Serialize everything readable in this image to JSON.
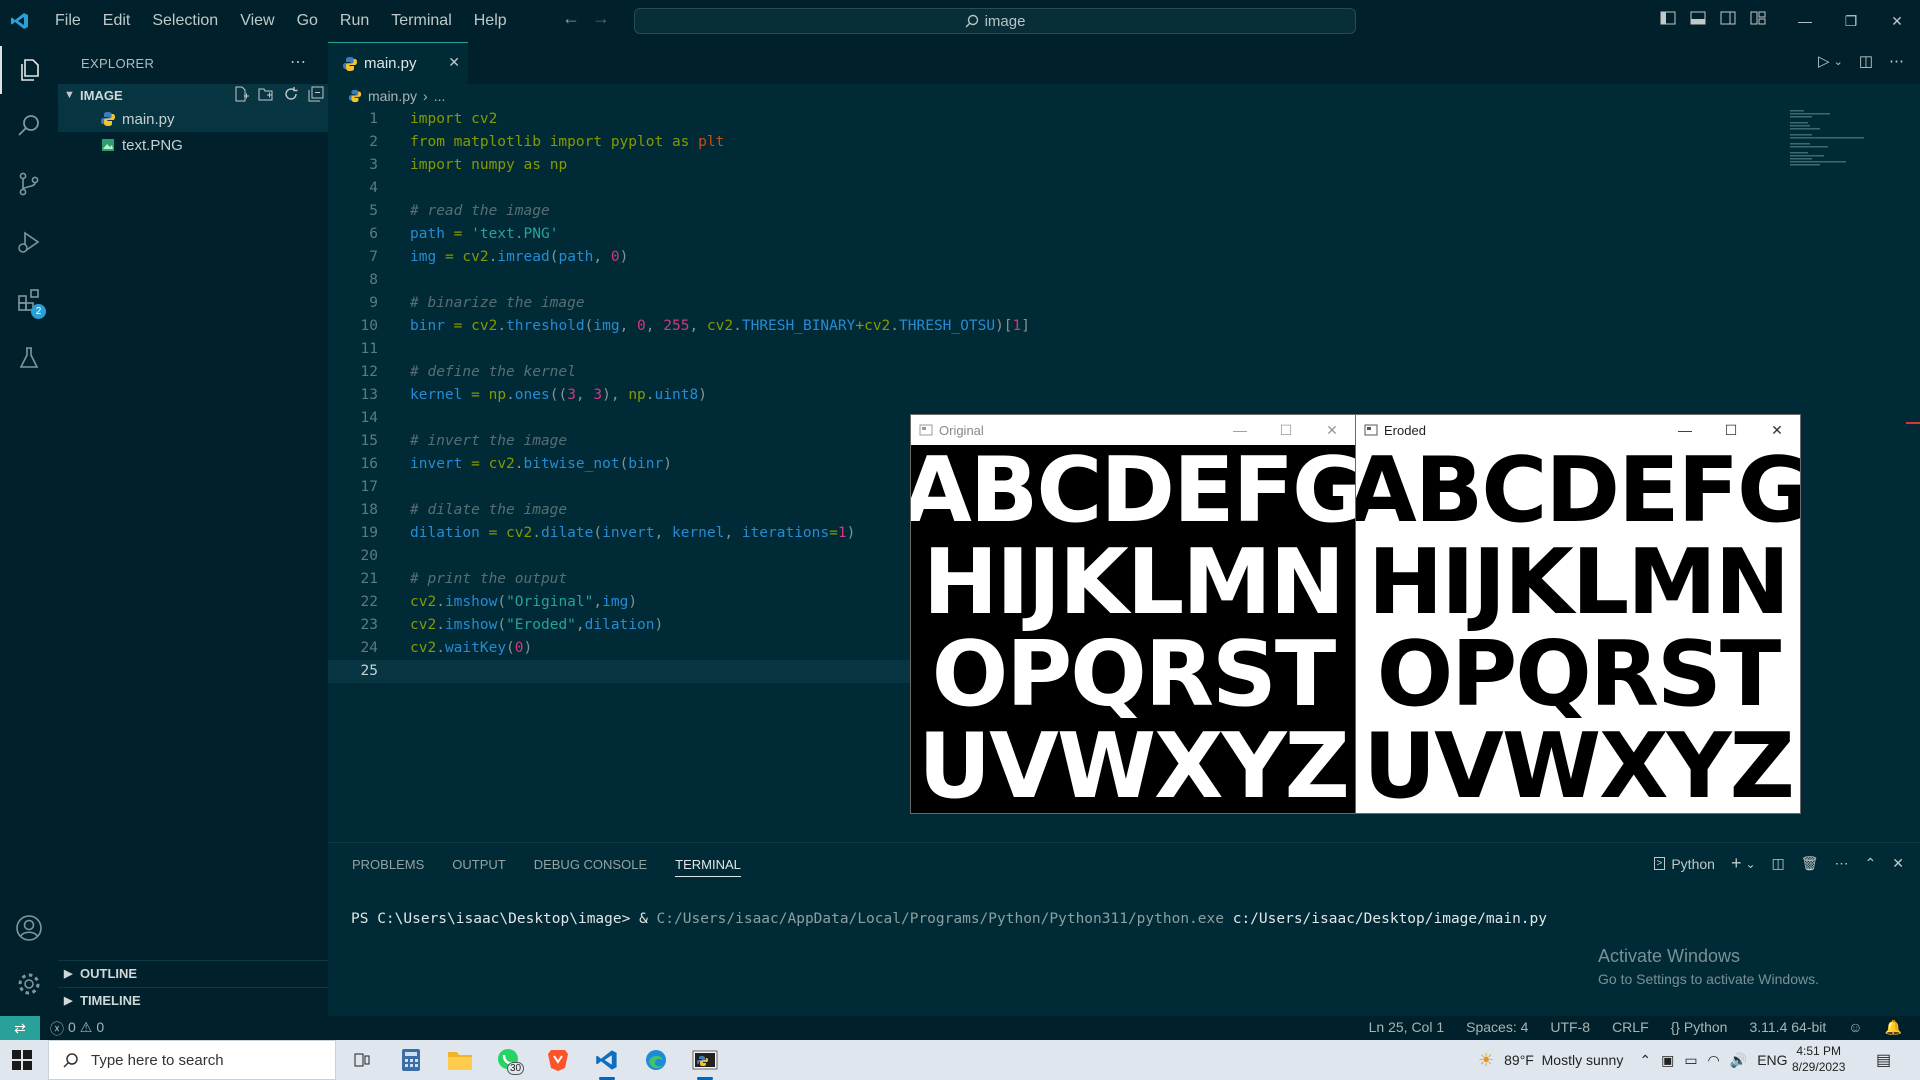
{
  "titlebar": {
    "menu": [
      "File",
      "Edit",
      "Selection",
      "View",
      "Go",
      "Run",
      "Terminal",
      "Help"
    ],
    "search": "image"
  },
  "activity": {
    "extensions_badge": "2"
  },
  "sidebar": {
    "title": "EXPLORER",
    "folder": "IMAGE",
    "files": [
      "main.py",
      "text.PNG"
    ],
    "outline": "OUTLINE",
    "timeline": "TIMELINE"
  },
  "editor": {
    "tab": "main.py",
    "breadcrumb": [
      "main.py",
      "..."
    ],
    "lines": [
      "import cv2",
      "from matplotlib import pyplot as plt",
      "import numpy as np",
      "",
      "# read the image",
      "path = 'text.PNG'",
      "img = cv2.imread(path, 0)",
      "",
      "# binarize the image",
      "binr = cv2.threshold(img, 0, 255, cv2.THRESH_BINARY+cv2.THRESH_OTSU)[1]",
      "",
      "# define the kernel",
      "kernel = np.ones((3, 3), np.uint8)",
      "",
      "# invert the image",
      "invert = cv2.bitwise_not(binr)",
      "",
      "# dilate the image",
      "dilation = cv2.dilate(invert, kernel, iterations=1)",
      "",
      "# print the output",
      "cv2.imshow(\"Original\",img)",
      "cv2.imshow(\"Eroded\",dilation)",
      "cv2.waitKey(0)",
      ""
    ],
    "current_line": 25
  },
  "panel": {
    "tabs": [
      "PROBLEMS",
      "OUTPUT",
      "DEBUG CONSOLE",
      "TERMINAL"
    ],
    "active_tab": "TERMINAL",
    "terminal_profile": "Python",
    "prompt": "PS C:\\Users\\isaac\\Desktop\\image> & ",
    "cmd_exe": "C:/Users/isaac/AppData/Local/Programs/Python/Python311/python.exe",
    "cmd_arg": " c:/Users/isaac/Desktop/image/main.py",
    "activate_title": "Activate Windows",
    "activate_sub": "Go to Settings to activate Windows."
  },
  "statusbar": {
    "errors": "0",
    "warnings": "0",
    "position": "Ln 25, Col 1",
    "spaces": "Spaces: 4",
    "encoding": "UTF-8",
    "eol": "CRLF",
    "language": "Python",
    "interpreter": "3.11.4 64-bit"
  },
  "cv_windows": {
    "original_title": "Original",
    "eroded_title": "Eroded",
    "rows": [
      "ABCDEFG",
      "HIJKLMN",
      "OPQRST",
      "UVWXYZ"
    ]
  },
  "taskbar": {
    "search_placeholder": "Type here to search",
    "whatsapp_badge": "30",
    "weather": "89°F  Mostly sunny",
    "lang": "ENG",
    "time": "4:51 PM",
    "date": "8/29/2023"
  },
  "colors": {
    "background": "#002b36",
    "keyword": "#859900",
    "function": "#268bd2",
    "string": "#2aa198",
    "number": "#d33682",
    "comment": "#586e75"
  }
}
